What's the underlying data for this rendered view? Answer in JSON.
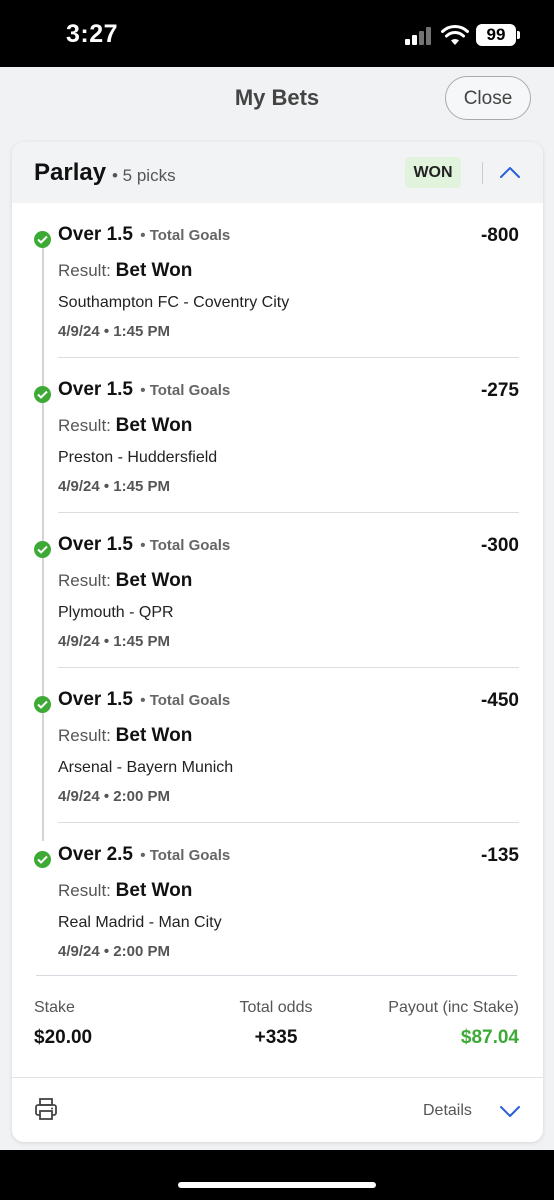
{
  "status_bar": {
    "time": "3:27",
    "battery": "99"
  },
  "header": {
    "title": "My Bets",
    "close_label": "Close"
  },
  "bet": {
    "type": "Parlay",
    "picks": "• 5 picks",
    "status": "WON",
    "legs": [
      {
        "line": "Over 1.5",
        "market": "• Total Goals",
        "odds": "-800",
        "result_label": "Result:",
        "result": "Bet Won",
        "match": "Southampton FC - Coventry City",
        "time": "4/9/24 • 1:45 PM"
      },
      {
        "line": "Over 1.5",
        "market": "• Total Goals",
        "odds": "-275",
        "result_label": "Result:",
        "result": "Bet Won",
        "match": "Preston - Huddersfield",
        "time": "4/9/24 • 1:45 PM"
      },
      {
        "line": "Over 1.5",
        "market": "• Total Goals",
        "odds": "-300",
        "result_label": "Result:",
        "result": "Bet Won",
        "match": "Plymouth - QPR",
        "time": "4/9/24 • 1:45 PM"
      },
      {
        "line": "Over 1.5",
        "market": "• Total Goals",
        "odds": "-450",
        "result_label": "Result:",
        "result": "Bet Won",
        "match": "Arsenal - Bayern Munich",
        "time": "4/9/24 • 2:00 PM"
      },
      {
        "line": "Over 2.5",
        "market": "• Total Goals",
        "odds": "-135",
        "result_label": "Result:",
        "result": "Bet Won",
        "match": "Real Madrid - Man City",
        "time": "4/9/24 • 2:00 PM"
      }
    ],
    "summary": {
      "stake_label": "Stake",
      "stake": "$20.00",
      "odds_label": "Total odds",
      "odds": "+335",
      "payout_label": "Payout (inc Stake)",
      "payout": "$87.04"
    },
    "footer": {
      "details_label": "Details",
      "print_icon": "printer-icon"
    }
  },
  "colors": {
    "won_green": "#3daa35",
    "won_badge_bg": "#e1f3dd",
    "accent_blue": "#2b5fd9"
  }
}
